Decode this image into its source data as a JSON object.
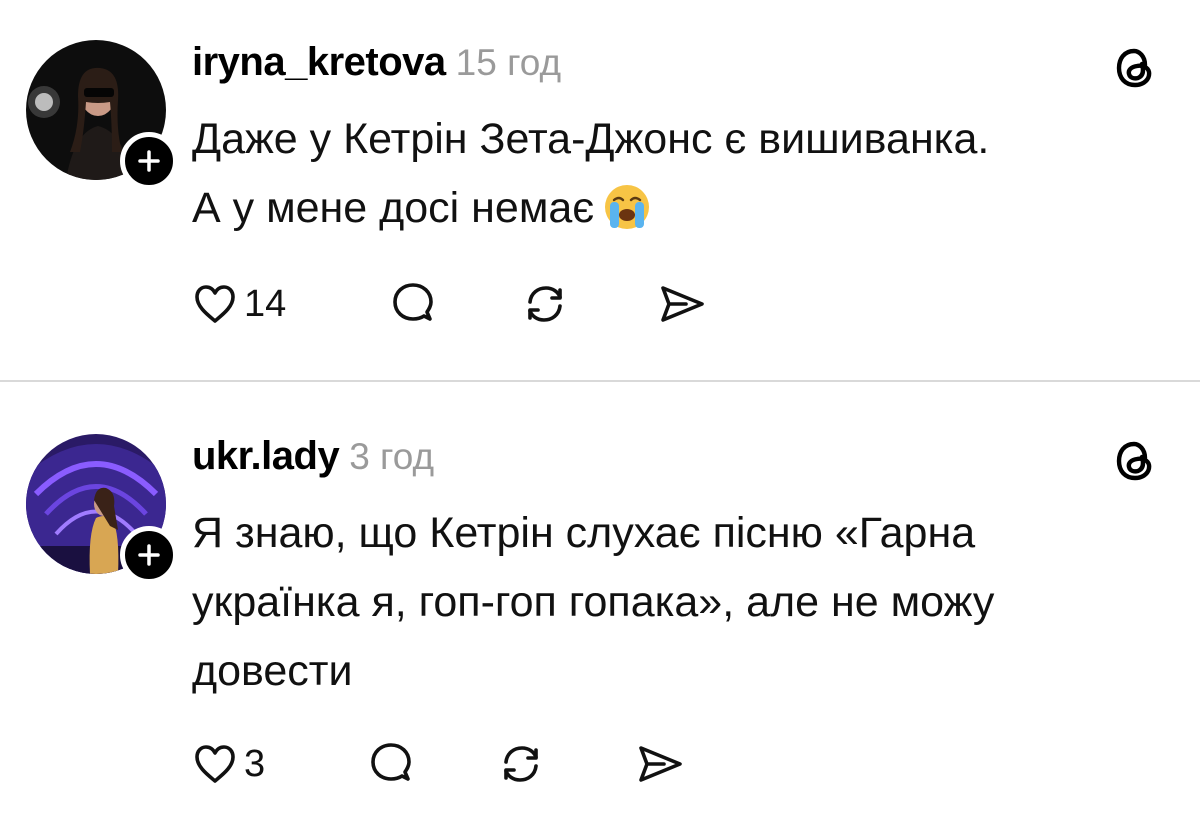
{
  "posts": [
    {
      "username": "iryna_kretova",
      "time": "15 год",
      "text_lines": [
        "Даже у Кетрін Зета-Джонс є вишиванка.",
        "А у мене досі немає"
      ],
      "emoji": "loudly-crying-face",
      "likes": "14"
    },
    {
      "username": "ukr.lady",
      "time": "3 год",
      "text_lines": [
        "Я знаю, що Кетрін слухає пісню «Гарна",
        "українка я, гоп-гоп гопака», але не можу",
        "довести"
      ],
      "likes": "3"
    }
  ],
  "icons": {
    "like": "heart-outline-icon",
    "reply": "speech-bubble-icon",
    "repost": "repost-arrows-icon",
    "share": "send-arrow-icon",
    "brand": "threads-logo-icon",
    "follow": "plus-icon"
  },
  "colors": {
    "text": "#111111",
    "meta": "#9a9a9a",
    "divider": "#d9d9d9",
    "badge": "#000000"
  }
}
